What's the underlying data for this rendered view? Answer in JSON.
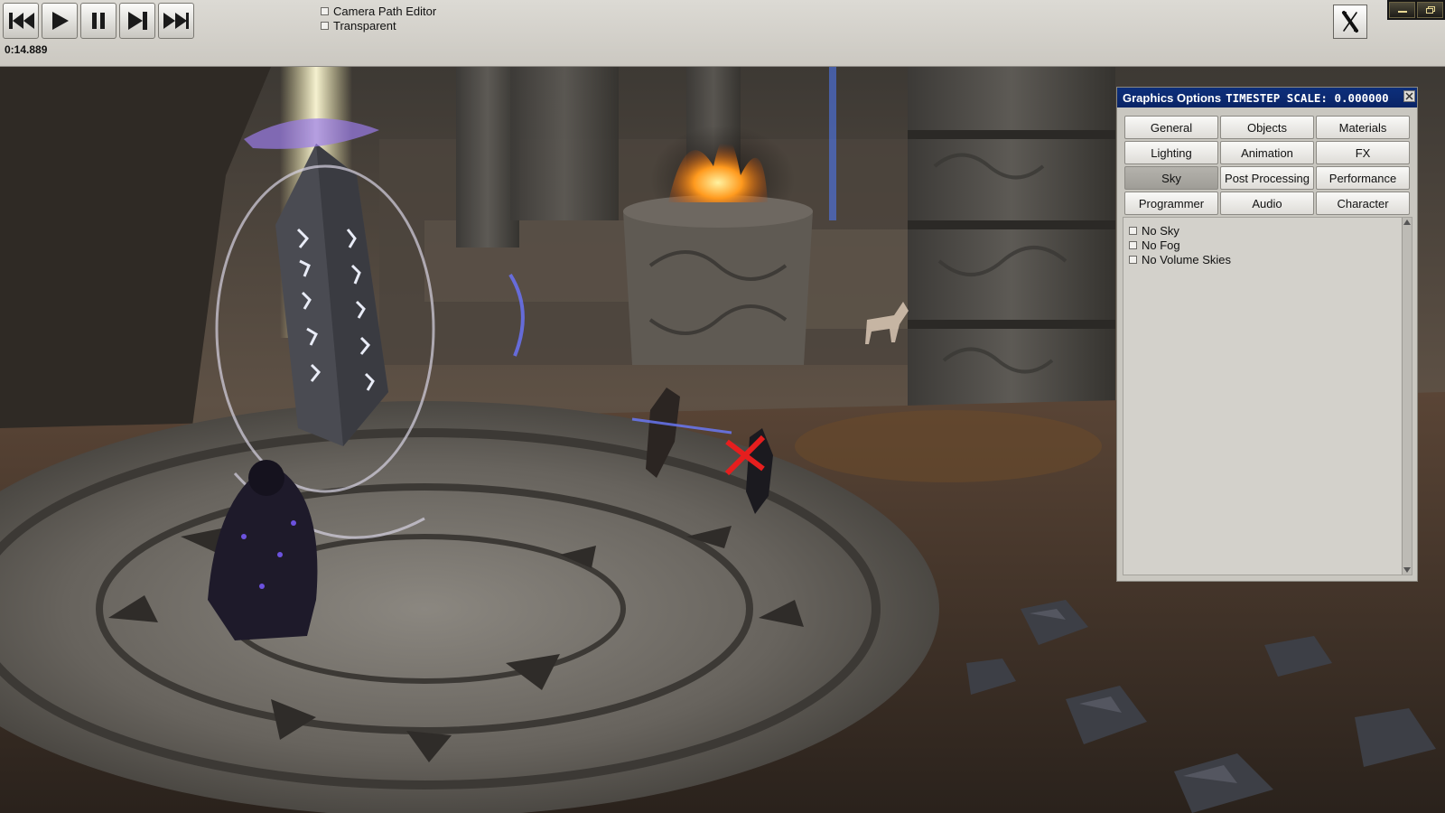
{
  "toolbar": {
    "buttons": [
      {
        "name": "rewind",
        "icon": "rewind-icon"
      },
      {
        "name": "play",
        "icon": "play-icon"
      },
      {
        "name": "pause",
        "icon": "pause-icon"
      },
      {
        "name": "step-forward",
        "icon": "step-forward-icon"
      },
      {
        "name": "fast-forward",
        "icon": "fast-forward-icon"
      }
    ],
    "timecode": "0:14.889",
    "checkboxes": [
      {
        "label": "Camera Path Editor",
        "checked": false
      },
      {
        "label": "Transparent",
        "checked": false
      }
    ],
    "close_icon": "close-x-icon"
  },
  "window_controls": [
    "minimize-icon",
    "restore-icon"
  ],
  "panel": {
    "title": "Graphics Options",
    "status": "TIMESTEP SCALE: 0.000000",
    "tabs": [
      "General",
      "Objects",
      "Materials",
      "Lighting",
      "Animation",
      "FX",
      "Sky",
      "Post Processing",
      "Performance",
      "Programmer",
      "Audio",
      "Character"
    ],
    "active_tab": "Sky",
    "options": [
      {
        "label": "No Sky",
        "checked": false
      },
      {
        "label": "No Fog",
        "checked": false
      },
      {
        "label": "No Volume Skies",
        "checked": false
      }
    ]
  },
  "colors": {
    "title_bar": "#0d2f7c",
    "panel_bg": "#c9c7c0",
    "toolbar_bg": "#d4d2cc"
  }
}
